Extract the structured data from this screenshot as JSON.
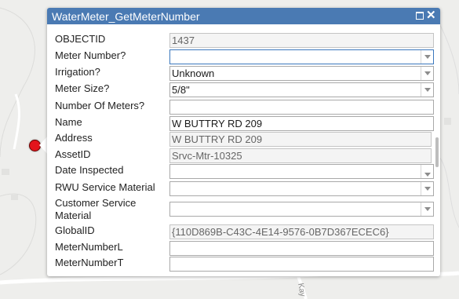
{
  "popup": {
    "title": "WaterMeter_GetMeterNumber",
    "fields": {
      "objectid": {
        "label": "OBJECTID",
        "value": "1437"
      },
      "meter_number": {
        "label": "Meter Number?",
        "value": ""
      },
      "irrigation": {
        "label": "Irrigation?",
        "value": "Unknown"
      },
      "meter_size": {
        "label": "Meter Size?",
        "value": "5/8\""
      },
      "number_of_meters": {
        "label": "Number Of Meters?",
        "value": ""
      },
      "name": {
        "label": "Name",
        "value": "W BUTTRY RD 209"
      },
      "address": {
        "label": "Address",
        "value": "W BUTTRY RD 209"
      },
      "asset_id": {
        "label": "AssetID",
        "value": "Srvc-Mtr-10325"
      },
      "date_inspected": {
        "label": "Date Inspected",
        "value": ""
      },
      "rwu_service_material": {
        "label": "RWU Service Material",
        "value": ""
      },
      "customer_service_material": {
        "label": "Customer Service Material",
        "value": ""
      },
      "global_id": {
        "label": "GlobalID",
        "value": "{110D869B-C43C-4E14-9576-0B7D367ECEC6}"
      },
      "meter_number_l": {
        "label": "MeterNumberL",
        "value": ""
      },
      "meter_number_t": {
        "label": "MeterNumberT",
        "value": ""
      }
    }
  },
  "map": {
    "street_label": "Kay"
  },
  "icons": {
    "maximize": "maximize-icon",
    "close": "close-icon",
    "dropdown": "chevron-down-icon",
    "marker": "map-marker"
  },
  "colors": {
    "header": "#4a7ab3",
    "marker": "#e3141b",
    "focus_border": "#3b78bd"
  }
}
